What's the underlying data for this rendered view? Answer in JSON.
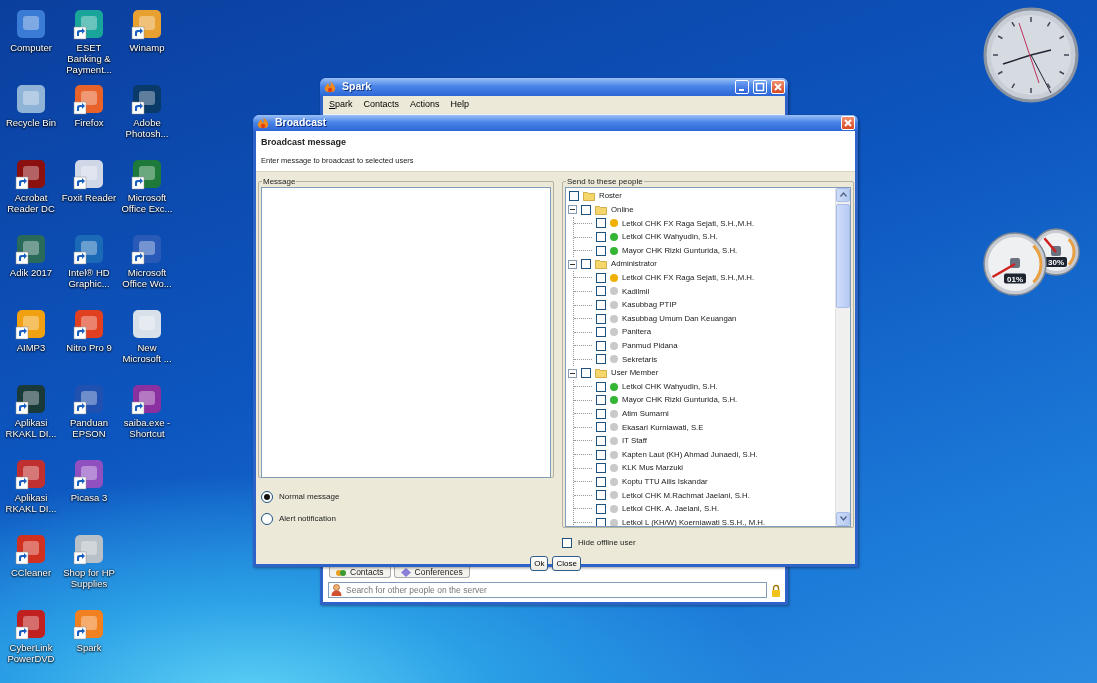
{
  "desktop_rows": [
    {
      "icons": [
        {
          "label": "Computer",
          "color": "#3a7bd5",
          "shortcut": false
        },
        {
          "label": "ESET Banking & Payment...",
          "color": "#1aa59a",
          "shortcut": true
        },
        {
          "label": "Winamp",
          "color": "#e8a030",
          "shortcut": true
        }
      ]
    },
    {
      "icons": [
        {
          "label": "Recycle Bin",
          "color": "#8fb4d8",
          "shortcut": false
        },
        {
          "label": "Firefox",
          "color": "#e8622a",
          "shortcut": true
        },
        {
          "label": "Adobe Photosh...",
          "color": "#0a3a6a",
          "shortcut": true
        }
      ]
    },
    {
      "icons": [
        {
          "label": "Acrobat Reader DC",
          "color": "#8b1010",
          "shortcut": true
        },
        {
          "label": "Foxit Reader",
          "color": "#d0d8e8",
          "shortcut": true
        },
        {
          "label": "Microsoft Office Exc...",
          "color": "#1e7a3a",
          "shortcut": true
        }
      ]
    },
    {
      "icons": [
        {
          "label": "Adik 2017",
          "color": "#2a6a5a",
          "shortcut": true
        },
        {
          "label": "Intel® HD Graphic...",
          "color": "#1a6ab8",
          "shortcut": true
        },
        {
          "label": "Microsoft Office Wo...",
          "color": "#2a5ab8",
          "shortcut": true
        }
      ]
    },
    {
      "icons": [
        {
          "label": "AIMP3",
          "color": "#f0a010",
          "shortcut": true
        },
        {
          "label": "Nitro Pro 9",
          "color": "#e04020",
          "shortcut": true
        },
        {
          "label": "New Microsoft ...",
          "color": "#d8e0ea",
          "shortcut": false
        }
      ]
    },
    {
      "icons": [
        {
          "label": "Aplikasi RKAKL DI...",
          "color": "#1a3a3a",
          "shortcut": true
        },
        {
          "label": "Panduan EPSON",
          "color": "#2050b0",
          "shortcut": true
        },
        {
          "label": "saiba.exe - Shortcut",
          "color": "#8a30a0",
          "shortcut": true
        }
      ]
    },
    {
      "icons": [
        {
          "label": "Aplikasi RKAKL DI...",
          "color": "#c03030",
          "shortcut": true
        },
        {
          "label": "Picasa 3",
          "color": "#9050c0",
          "shortcut": true
        }
      ]
    },
    {
      "icons": [
        {
          "label": "CCleaner",
          "color": "#d03020",
          "shortcut": true
        },
        {
          "label": "Shop for HP Supplies",
          "color": "#b8c0c8",
          "shortcut": true
        }
      ]
    },
    {
      "icons": [
        {
          "label": "CyberLink PowerDVD",
          "color": "#c02020",
          "shortcut": true
        },
        {
          "label": "Spark",
          "color": "#f08020",
          "shortcut": true
        }
      ]
    }
  ],
  "spark_window": {
    "title": "Spark",
    "menu": [
      {
        "label": "Spark",
        "mnemonic": true
      },
      {
        "label": "Contacts",
        "mnemonic": false
      },
      {
        "label": "Actions",
        "mnemonic": false
      },
      {
        "label": "Help",
        "mnemonic": false
      }
    ],
    "tabs": [
      {
        "label": "Contacts"
      },
      {
        "label": "Conferences"
      }
    ],
    "search": {
      "placeholder": "Search for other people on the server"
    }
  },
  "broadcast_dialog": {
    "title": "Broadcast",
    "heading": "Broadcast message",
    "subtitle": "Enter message to broadcast to selected users",
    "message_legend": "Message",
    "options": [
      {
        "label": "Normal message",
        "selected": true
      },
      {
        "label": "Alert notification",
        "selected": false
      }
    ],
    "people_legend": "Send to these people",
    "tree": {
      "label": "Roster",
      "checked": false,
      "children": [
        {
          "label": "Online",
          "checked": false,
          "expanded": true,
          "children": [
            {
              "label": "Letkol CHK FX Raga Sejati, S.H.,M.H.",
              "color": "#f0b000",
              "checked": false
            },
            {
              "label": "Letkol CHK Wahyudin, S.H.",
              "color": "#35b535",
              "checked": false
            },
            {
              "label": "Mayor CHK Rizki Gunturida, S.H.",
              "color": "#35b535",
              "checked": false
            }
          ]
        },
        {
          "label": "Administrator",
          "checked": false,
          "expanded": true,
          "children": [
            {
              "label": "Letkol CHK FX Raga Sejati, S.H.,M.H.",
              "color": "#f0b000",
              "checked": false
            },
            {
              "label": "Kadilmil",
              "color": "#c9c9c9",
              "checked": false
            },
            {
              "label": "Kasubbag PTIP",
              "color": "#c9c9c9",
              "checked": false
            },
            {
              "label": "Kasubbag Umum Dan Keuangan",
              "color": "#c9c9c9",
              "checked": false
            },
            {
              "label": "Panitera",
              "color": "#c9c9c9",
              "checked": false
            },
            {
              "label": "Panmud Pidana",
              "color": "#c9c9c9",
              "checked": false
            },
            {
              "label": "Sekretaris",
              "color": "#c9c9c9",
              "checked": false
            }
          ]
        },
        {
          "label": "User Member",
          "checked": false,
          "expanded": true,
          "children": [
            {
              "label": "Letkol CHK Wahyudin, S.H.",
              "color": "#35b535",
              "checked": false
            },
            {
              "label": "Mayor CHK Rizki Gunturida, S.H.",
              "color": "#35b535",
              "checked": false
            },
            {
              "label": "Atim Sumarni",
              "color": "#c9c9c9",
              "checked": false
            },
            {
              "label": "Ekasari Kurniawati, S.E",
              "color": "#c9c9c9",
              "checked": false
            },
            {
              "label": "IT Staff",
              "color": "#c9c9c9",
              "checked": false
            },
            {
              "label": "Kapten Laut (KH) Ahmad Junaedi, S.H.",
              "color": "#c9c9c9",
              "checked": false
            },
            {
              "label": "KLK Mus Marzuki",
              "color": "#c9c9c9",
              "checked": false
            },
            {
              "label": "Koptu TTU Ailis Iskandar",
              "color": "#c9c9c9",
              "checked": false
            },
            {
              "label": "Letkol CHK M.Rachmat Jaelani, S.H.",
              "color": "#c9c9c9",
              "checked": false
            },
            {
              "label": "Letkol CHK. A. Jaelani, S.H.",
              "color": "#c9c9c9",
              "checked": false
            },
            {
              "label": "Letkol L (KH/W) Koerniawati S.S.H., M.H.",
              "color": "#c9c9c9",
              "checked": false
            }
          ]
        }
      ]
    },
    "hide_offline": {
      "label": "Hide offline user",
      "checked": false
    },
    "buttons": [
      {
        "label": "Ok"
      },
      {
        "label": "Close"
      }
    ]
  },
  "gadgets": {
    "meters": [
      {
        "reading": "01%"
      },
      {
        "reading": "30%"
      }
    ]
  }
}
